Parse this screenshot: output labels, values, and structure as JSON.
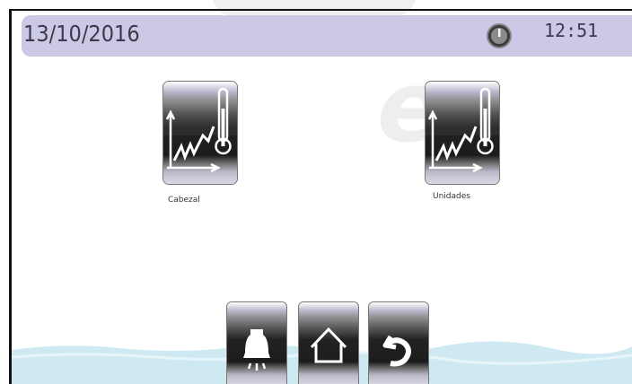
{
  "header": {
    "date": "13/10/2016",
    "time": "12:51",
    "clock_icon": "clock-icon"
  },
  "tiles": [
    {
      "label": "Cabezal",
      "icon": "chart-thermometer-icon"
    },
    {
      "label": "Unidades",
      "icon": "chart-thermometer-icon"
    }
  ],
  "nav": [
    {
      "icon": "alarm-bell-icon"
    },
    {
      "icon": "home-icon"
    },
    {
      "icon": "back-arrow-icon"
    }
  ],
  "colors": {
    "header_bg": "#ccc9e7",
    "text": "#3b3b4a",
    "tile_dark": "#1f1f1f",
    "wave": "#cfe9f2"
  }
}
